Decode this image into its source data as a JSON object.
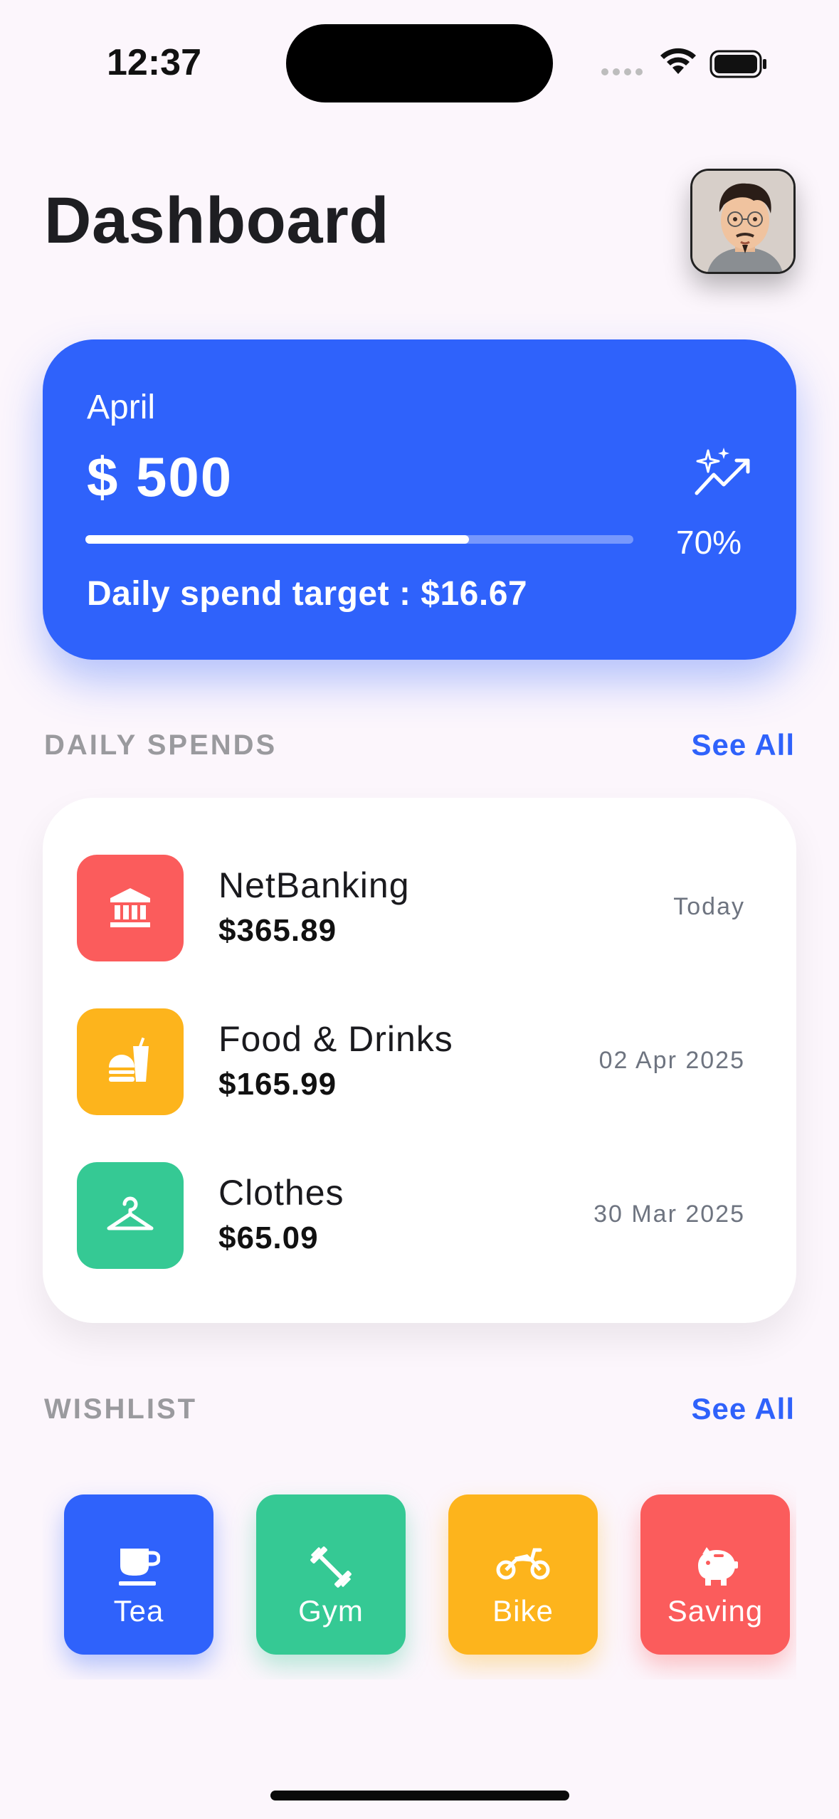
{
  "status_bar": {
    "time": "12:37"
  },
  "header": {
    "title": "Dashboard"
  },
  "budget": {
    "month": "April",
    "amount": "$ 500",
    "progress_fraction": 0.7,
    "percent_label": "70%",
    "daily_target": "Daily spend target : $16.67",
    "icon": "sparkle-trend-icon"
  },
  "daily_spends": {
    "title": "DAILY SPENDS",
    "see_all": "See All",
    "items": [
      {
        "name": "NetBanking",
        "amount": "$365.89",
        "date": "Today",
        "icon": "bank-icon",
        "color": "#fb5c5c"
      },
      {
        "name": "Food & Drinks",
        "amount": "$165.99",
        "date": "02 Apr 2025",
        "icon": "food-drink-icon",
        "color": "#fdb41c"
      },
      {
        "name": "Clothes",
        "amount": "$65.09",
        "date": "30 Mar 2025",
        "icon": "hanger-icon",
        "color": "#35c994"
      }
    ]
  },
  "wishlist": {
    "title": "WISHLIST",
    "see_all": "See All",
    "items": [
      {
        "label": "Tea",
        "icon": "tea-cup-icon",
        "color": "#2f62fb"
      },
      {
        "label": "Gym",
        "icon": "dumbbell-icon",
        "color": "#35c994"
      },
      {
        "label": "Bike",
        "icon": "motorcycle-icon",
        "color": "#fdb41c"
      },
      {
        "label": "Saving",
        "icon": "piggy-bank-icon",
        "color": "#fb5c5c"
      }
    ]
  },
  "colors": {
    "accent": "#2f62fb",
    "background": "#fcf6fc"
  }
}
